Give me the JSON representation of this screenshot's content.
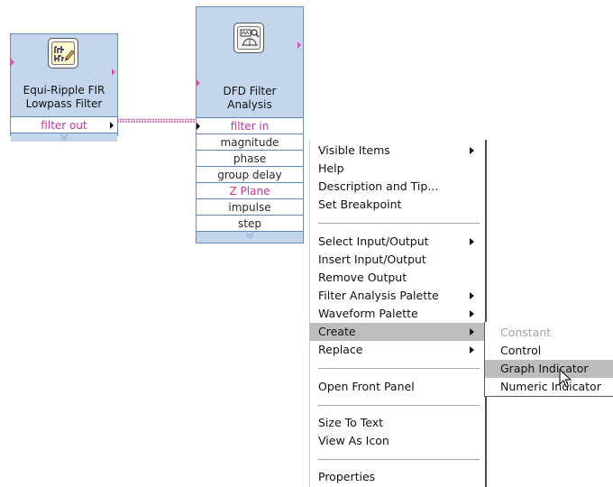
{
  "nodes": {
    "fir": {
      "title": "Equi-Ripple FIR\nLowpass Filter",
      "terminal": "filter out"
    },
    "dfd": {
      "title": "DFD Filter\nAnalysis",
      "terminals": [
        {
          "label": "filter in",
          "kind": "pink"
        },
        {
          "label": "magnitude",
          "kind": "wave"
        },
        {
          "label": "phase",
          "kind": "wave"
        },
        {
          "label": "group delay",
          "kind": "wave"
        },
        {
          "label": "Z Plane",
          "kind": "pink"
        },
        {
          "label": "impulse",
          "kind": "wave"
        },
        {
          "label": "step",
          "kind": "wave"
        }
      ]
    }
  },
  "context_menu": {
    "items": [
      {
        "label": "Visible Items",
        "submenu": true
      },
      {
        "label": "Help"
      },
      {
        "label": "Description and Tip..."
      },
      {
        "label": "Set Breakpoint"
      },
      {
        "label": "Select Input/Output",
        "submenu": true
      },
      {
        "label": "Insert Input/Output"
      },
      {
        "label": "Remove Output"
      },
      {
        "label": "Filter Analysis Palette",
        "submenu": true
      },
      {
        "label": "Waveform Palette",
        "submenu": true
      },
      {
        "label": "Create",
        "submenu": true,
        "highlighted": true
      },
      {
        "label": "Replace",
        "submenu": true
      },
      {
        "label": "Open Front Panel"
      },
      {
        "label": "Size To Text"
      },
      {
        "label": "View As Icon"
      },
      {
        "label": "Properties"
      }
    ]
  },
  "create_submenu": {
    "items": [
      {
        "label": "Constant",
        "disabled": true
      },
      {
        "label": "Control"
      },
      {
        "label": "Graph Indicator",
        "highlighted": true
      },
      {
        "label": "Numeric Indicator"
      }
    ]
  },
  "colors": {
    "node_fill": "#c3d6ec",
    "node_border": "#6b8fb8",
    "wire": "#d45ab0",
    "menu_highlight": "#bdbdbd"
  },
  "icons": [
    "filter-design-icon",
    "filter-analysis-icon",
    "submenu-arrow-icon",
    "expand-chevron-icon",
    "mouse-cursor-icon"
  ]
}
